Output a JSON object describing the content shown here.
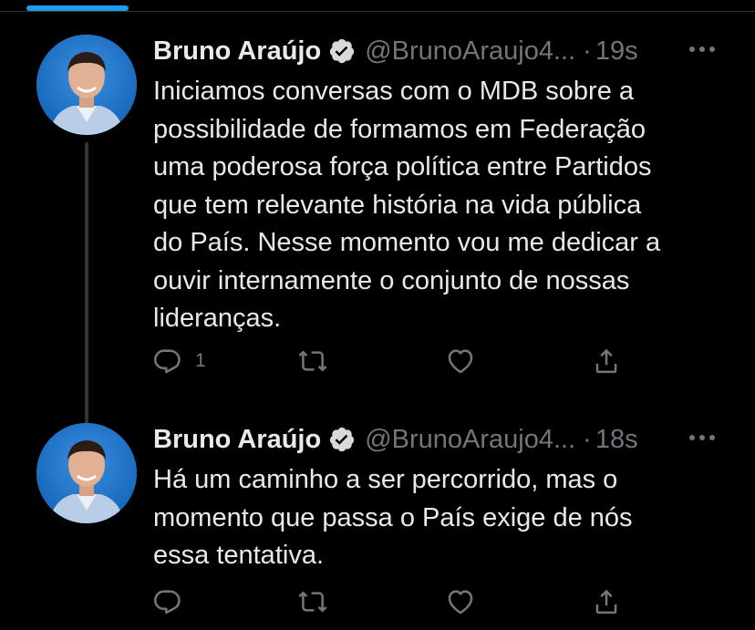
{
  "colors": {
    "background": "#000000",
    "text": "#e7e9ea",
    "muted": "#71767b",
    "accent": "#1d9bf0",
    "verified_badge": "#d9d9d9"
  },
  "tweets": [
    {
      "author_name": "Bruno Araújo",
      "handle": "@BrunoAraujo4...",
      "dot": "·",
      "time": "19s",
      "verified_icon": "verified-badge-icon",
      "text": "Iniciamos conversas com o MDB sobre a\npossibilidade de formamos em Federação\numa poderosa força política entre Partidos\nque tem relevante história na vida pública\ndo País. Nesse momento vou me dedicar a\nouvir internamente o conjunto de nossas\nlideranças.",
      "reply_count": "1",
      "retweet_count": "",
      "like_count": "",
      "actions": [
        "reply-icon",
        "retweet-icon",
        "like-icon",
        "share-icon"
      ]
    },
    {
      "author_name": "Bruno Araújo",
      "handle": "@BrunoAraujo4...",
      "dot": "·",
      "time": "18s",
      "verified_icon": "verified-badge-icon",
      "text": "Há um caminho a ser percorrido, mas o\nmomento que passa o País exige de nós\nessa tentativa.",
      "reply_count": "",
      "retweet_count": "",
      "like_count": "",
      "actions": [
        "reply-icon",
        "retweet-icon",
        "like-icon",
        "share-icon"
      ]
    }
  ]
}
